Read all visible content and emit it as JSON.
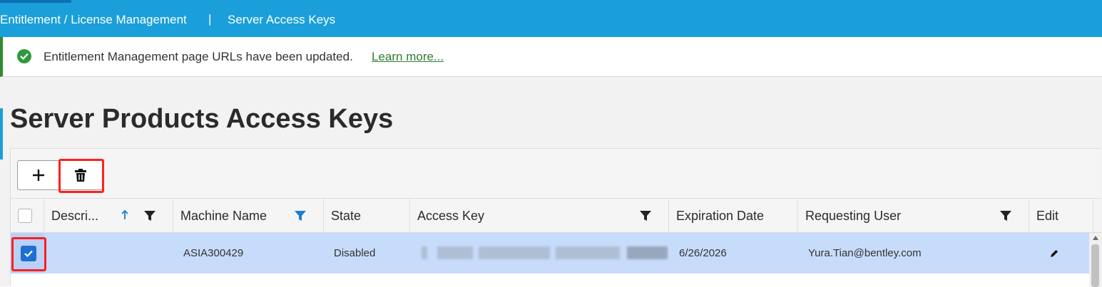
{
  "breadcrumb": {
    "section": "Entitlement / License Management",
    "separator": "|",
    "page": "Server Access Keys"
  },
  "notification": {
    "message": "Entitlement Management page URLs have been updated.",
    "link": "Learn more...",
    "icon": "check-circle-icon",
    "color": "#2e9a3e"
  },
  "page": {
    "title": "Server Products Access Keys"
  },
  "toolbar": {
    "add_icon": "plus-icon",
    "delete_icon": "trash-icon"
  },
  "table": {
    "columns": [
      {
        "label": "Descri...",
        "sort": "ascending",
        "filter": true
      },
      {
        "label": "Machine Name",
        "filter": true,
        "filter_active": true
      },
      {
        "label": "State",
        "filter": false
      },
      {
        "label": "Access Key",
        "filter": true
      },
      {
        "label": "Expiration Date",
        "filter": false
      },
      {
        "label": "Requesting User",
        "filter": true
      },
      {
        "label": "Edit",
        "filter": false
      }
    ],
    "rows": [
      {
        "selected": true,
        "description": "",
        "machine_name": "ASIA300429",
        "state": "Disabled",
        "access_key": "(obscured)",
        "expiration_date": "6/26/2026",
        "requesting_user": "Yura.Tian@bentley.com",
        "edit_icon": "pencil-icon"
      }
    ]
  },
  "colors": {
    "header_bar": "#1a9fda",
    "selected_row": "#c7dcfa",
    "checkbox": "#1f6fd1",
    "highlight": "#ff2020"
  }
}
